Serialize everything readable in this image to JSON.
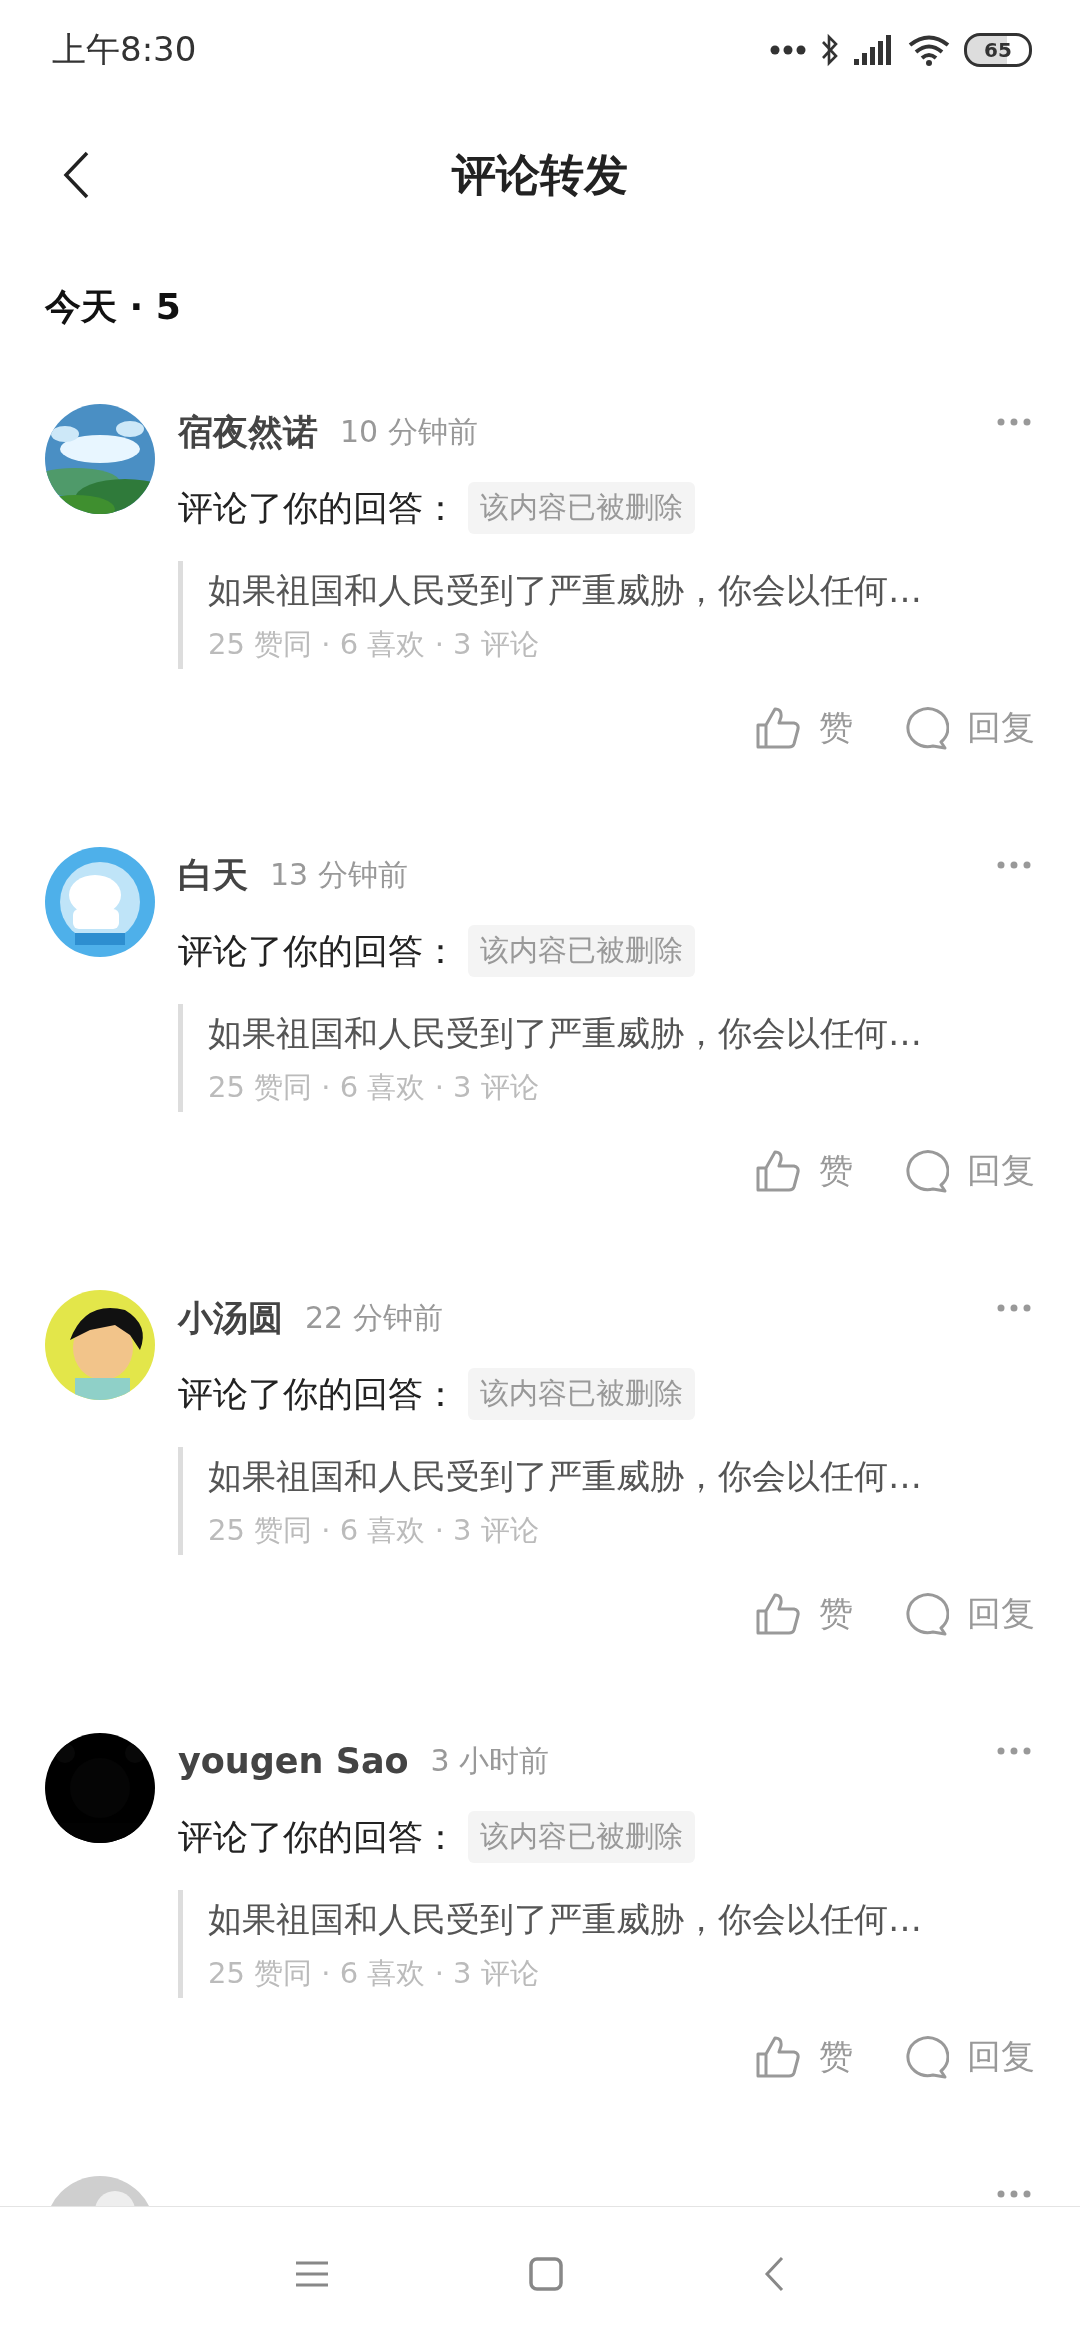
{
  "status_bar": {
    "time": "上午8:30",
    "battery": "65"
  },
  "header": {
    "title": "评论转发"
  },
  "section": {
    "title": "今天 · 5"
  },
  "notifications": [
    {
      "kind": "full",
      "name": "宿夜然诺",
      "time": "10 分钟前",
      "action": "评论了你的回答：",
      "tag": "该内容已被删除",
      "quote": "如果祖国和人民受到了严重威胁，你会以任何…",
      "stats": "25 赞同 · 6 喜欢 · 3 评论",
      "like": "赞",
      "reply": "回复"
    },
    {
      "kind": "full",
      "name": "白天",
      "time": "13 分钟前",
      "action": "评论了你的回答：",
      "tag": "该内容已被删除",
      "quote": "如果祖国和人民受到了严重威胁，你会以任何…",
      "stats": "25 赞同 · 6 喜欢 · 3 评论",
      "like": "赞",
      "reply": "回复"
    },
    {
      "kind": "full",
      "name": "小汤圆",
      "time": "22 分钟前",
      "action": "评论了你的回答：",
      "tag": "该内容已被删除",
      "quote": "如果祖国和人民受到了严重威胁，你会以任何…",
      "stats": "25 赞同 · 6 喜欢 · 3 评论",
      "like": "赞",
      "reply": "回复"
    },
    {
      "kind": "full",
      "name": "yougen Sao",
      "time": "3 小时前",
      "action": "评论了你的回答：",
      "tag": "该内容已被删除",
      "quote": "如果祖国和人民受到了严重威胁，你会以任何…",
      "stats": "25 赞同 · 6 喜欢 · 3 评论",
      "like": "赞",
      "reply": "回复"
    },
    {
      "kind": "cut_off"
    }
  ]
}
